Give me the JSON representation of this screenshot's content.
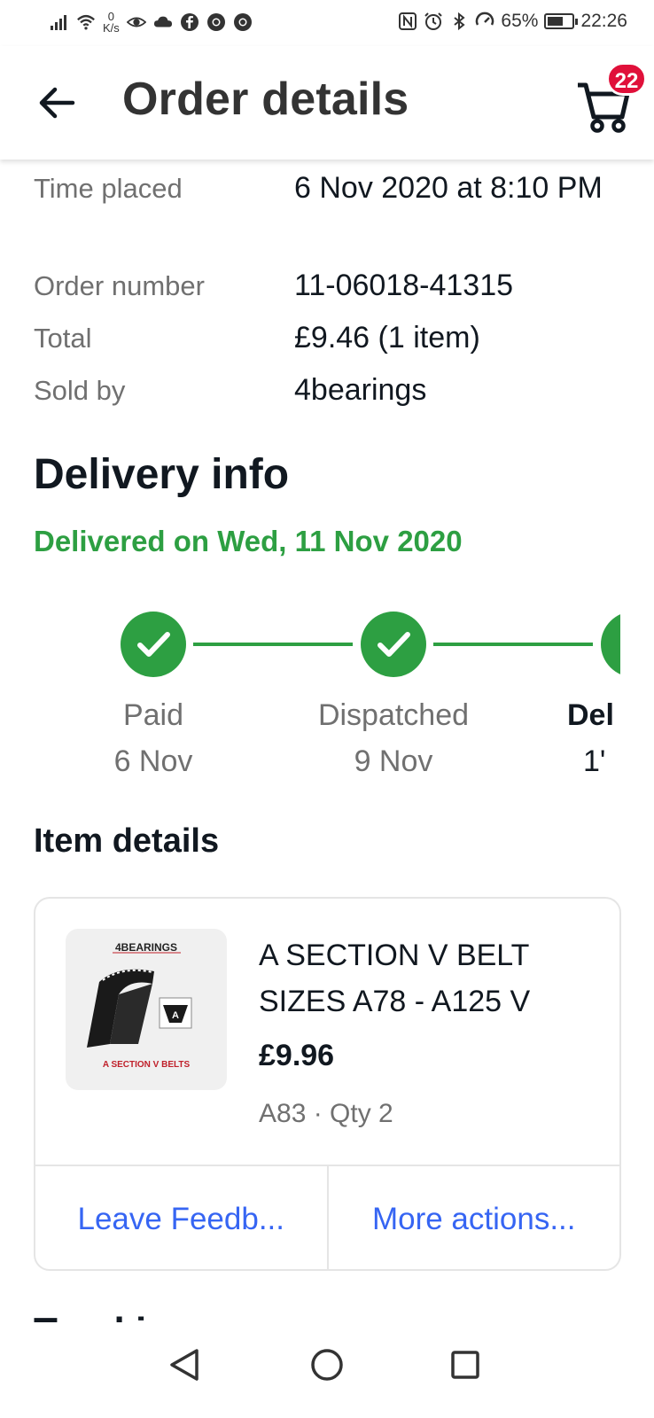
{
  "status_bar": {
    "net_speed_value": "0",
    "net_speed_unit": "K/s",
    "battery_percent": "65%",
    "battery_level": 0.65,
    "time": "22:26"
  },
  "header": {
    "title": "Order details",
    "cart_count": "22"
  },
  "order": {
    "time_placed_label": "Time placed",
    "time_placed_value": "6 Nov 2020 at 8:10 PM",
    "order_number_label": "Order number",
    "order_number_value": "11-06018-41315",
    "total_label": "Total",
    "total_value": "£9.46 (1 item)",
    "sold_by_label": "Sold by",
    "sold_by_value": "4bearings"
  },
  "delivery": {
    "title": "Delivery info",
    "status": "Delivered on Wed, 11 Nov 2020",
    "steps": [
      {
        "label": "Paid",
        "date": "6 Nov"
      },
      {
        "label": "Dispatched",
        "date": "9 Nov"
      },
      {
        "label": "Del",
        "date": "1'"
      }
    ]
  },
  "item_details": {
    "title": "Item details",
    "item": {
      "thumb_brand": "4BEARINGS",
      "thumb_caption": "A SECTION V BELTS",
      "thumb_badge": "A",
      "title": "A SECTION V BELT SIZES A78 - A125 V",
      "price": "£9.96",
      "meta": "A83 · Qty 2"
    },
    "actions": {
      "leave_feedback": "Leave Feedb...",
      "more_actions": "More actions..."
    }
  },
  "next_section_title": "Tracking details",
  "colors": {
    "accent_green": "#2d9f42",
    "link_blue": "#3665f3",
    "badge_red": "#e0103a"
  }
}
